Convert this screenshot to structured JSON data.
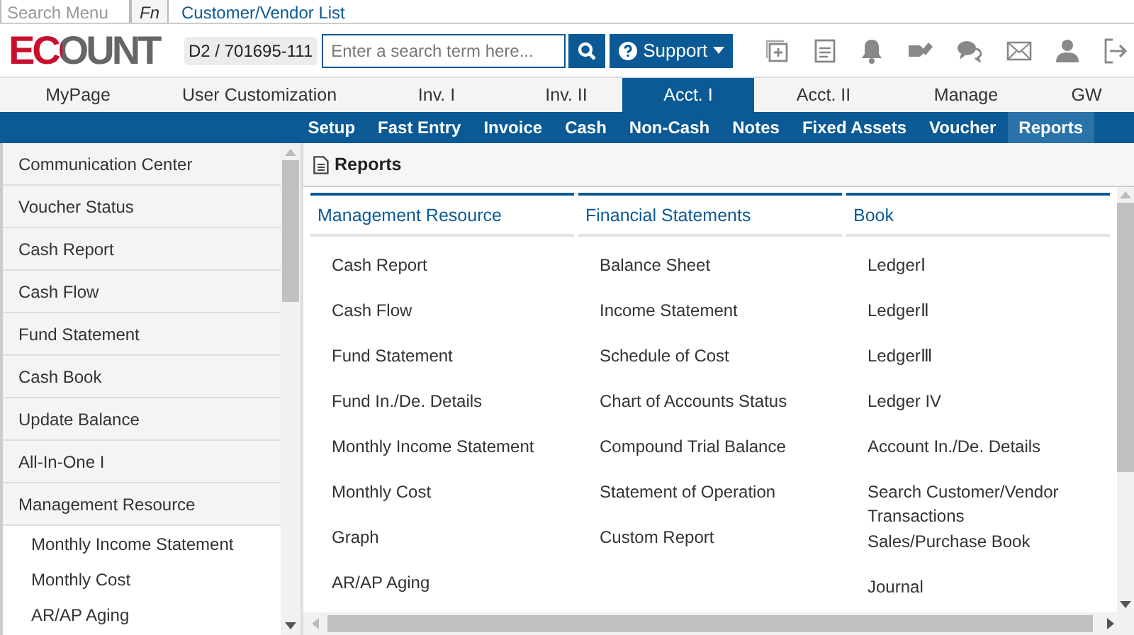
{
  "top_bar": {
    "search_menu": {
      "placeholder": "Search Menu"
    },
    "fn_key": "Fn",
    "link": "Customer/Vendor List"
  },
  "header": {
    "logo": "ECOUNT",
    "company_code": "D2 / 701695-111",
    "search": {
      "placeholder": "Enter a search term here..."
    },
    "support": "Support"
  },
  "tabs": [
    {
      "label": "MyPage",
      "selected": false
    },
    {
      "label": "User Customization",
      "selected": false
    },
    {
      "label": "Inv. I",
      "selected": false
    },
    {
      "label": "Inv. II",
      "selected": false
    },
    {
      "label": "Acct. I",
      "selected": true
    },
    {
      "label": "Acct. II",
      "selected": false
    },
    {
      "label": "Manage",
      "selected": false
    },
    {
      "label": "GW",
      "selected": false
    }
  ],
  "subnav": [
    {
      "label": "Setup",
      "selected": false
    },
    {
      "label": "Fast Entry",
      "selected": false
    },
    {
      "label": "Invoice",
      "selected": false
    },
    {
      "label": "Cash",
      "selected": false
    },
    {
      "label": "Non-Cash",
      "selected": false
    },
    {
      "label": "Notes",
      "selected": false
    },
    {
      "label": "Fixed Assets",
      "selected": false
    },
    {
      "label": "Voucher",
      "selected": false
    },
    {
      "label": "Reports",
      "selected": true
    }
  ],
  "sidebar": {
    "items": [
      {
        "label": "Communication Center",
        "kind": "section"
      },
      {
        "label": "Voucher Status",
        "kind": "section"
      },
      {
        "label": "Cash Report",
        "kind": "section"
      },
      {
        "label": "Cash Flow",
        "kind": "section"
      },
      {
        "label": "Fund Statement",
        "kind": "section"
      },
      {
        "label": "Cash Book",
        "kind": "section"
      },
      {
        "label": "Update Balance",
        "kind": "section"
      },
      {
        "label": "All-In-One I",
        "kind": "section"
      },
      {
        "label": "Management Resource",
        "kind": "section"
      },
      {
        "label": "Monthly Income Statement",
        "kind": "sub"
      },
      {
        "label": "Monthly Cost",
        "kind": "sub"
      },
      {
        "label": "AR/AP Aging",
        "kind": "sub"
      }
    ]
  },
  "content": {
    "title": "Reports",
    "columns": [
      {
        "title": "Management Resource",
        "items": [
          "Cash Report",
          "Cash Flow",
          "Fund Statement",
          "Fund In./De. Details",
          "Monthly Income Statement",
          "Monthly Cost",
          "Graph",
          "AR/AP Aging"
        ]
      },
      {
        "title": "Financial Statements",
        "items": [
          "Balance Sheet",
          "Income Statement",
          "Schedule of Cost",
          "Chart of Accounts Status",
          "Compound Trial Balance",
          "Statement of Operation",
          "Custom Report"
        ]
      },
      {
        "title": "Book",
        "items": [
          "LedgerⅠ",
          "LedgerⅡ",
          "LedgerⅢ",
          "Ledger IV",
          "Account In./De. Details",
          "Search Customer/Vendor Transactions",
          "Sales/Purchase Book",
          "Journal"
        ]
      }
    ]
  }
}
